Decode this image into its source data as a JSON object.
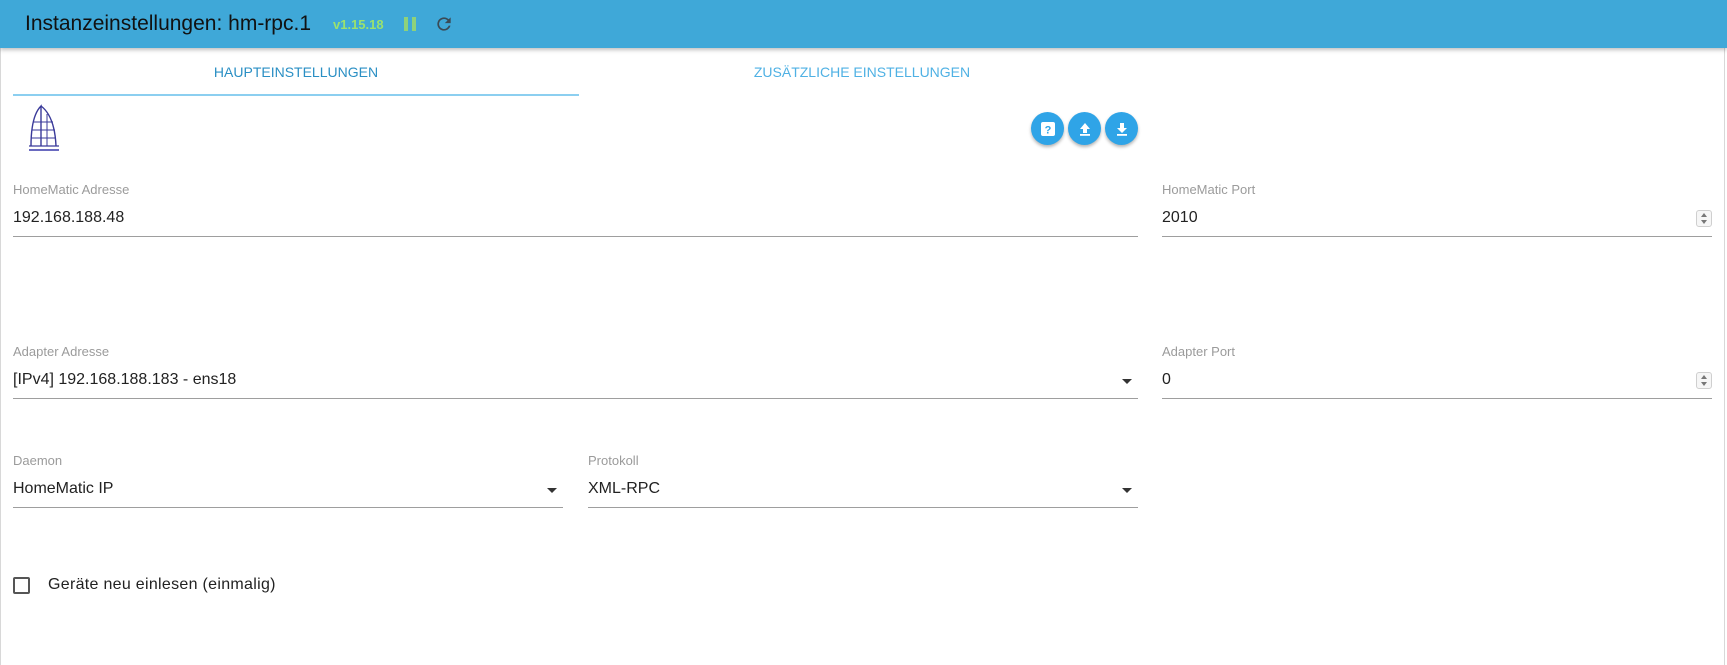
{
  "header": {
    "title": "Instanzeinstellungen: hm-rpc.1",
    "version": "v1.15.18",
    "pause_icon": "pause-icon",
    "reload_icon": "reload-icon"
  },
  "tabs": [
    {
      "label": "HAUPTEINSTELLUNGEN",
      "active": true
    },
    {
      "label": "ZUSÄTZLICHE EINSTELLUNGEN",
      "active": false
    }
  ],
  "toolbar": {
    "help_icon": "help-icon",
    "upload_icon": "upload-icon",
    "download_icon": "download-icon",
    "button_color": "#2fa4e7"
  },
  "fields": {
    "homematic_address": {
      "label": "HomeMatic Adresse",
      "value": "192.168.188.48"
    },
    "homematic_port": {
      "label": "HomeMatic Port",
      "value": "2010"
    },
    "adapter_address": {
      "label": "Adapter Adresse",
      "value": "[IPv4] 192.168.188.183 - ens18"
    },
    "adapter_port": {
      "label": "Adapter Port",
      "value": "0"
    },
    "daemon": {
      "label": "Daemon",
      "value": "HomeMatic IP"
    },
    "protocol": {
      "label": "Protokoll",
      "value": "XML-RPC"
    }
  },
  "checkbox": {
    "label": "Geräte neu einlesen (einmalig)",
    "checked": false
  },
  "colors": {
    "header_bg": "#3fa8d8",
    "accent": "#2fa4e7",
    "version": "#9be26e"
  }
}
